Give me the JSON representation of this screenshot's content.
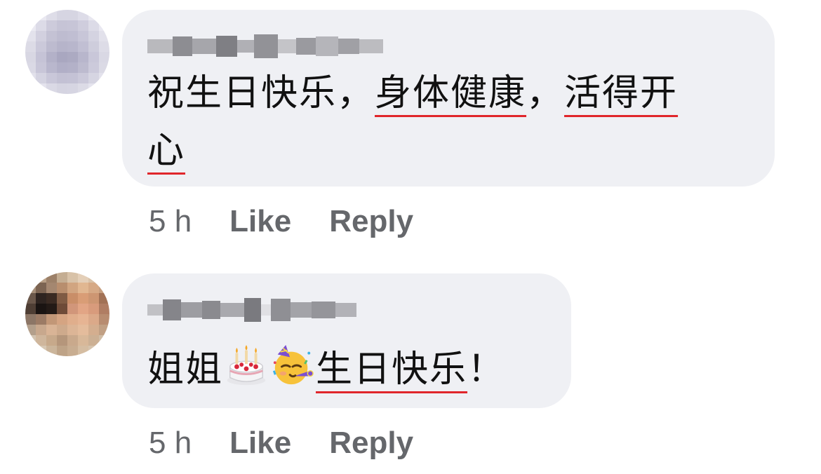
{
  "comments": [
    {
      "author_name": "",
      "text_parts": [
        {
          "t": "祝生日快乐，",
          "u": false
        },
        {
          "t": "身体健康",
          "u": true
        },
        {
          "t": "，",
          "u": false
        },
        {
          "t": "活得开",
          "u": true
        }
      ],
      "text_line2": [
        {
          "t": "心",
          "u": true
        }
      ],
      "time": "5 h",
      "like_label": "Like",
      "reply_label": "Reply"
    },
    {
      "author_name": "",
      "text_before": "姐姐",
      "emojis": [
        "birthday-cake-icon",
        "partying-face-icon"
      ],
      "text_underlined": "生日快乐",
      "text_after": "！",
      "time": "5 h",
      "like_label": "Like",
      "reply_label": "Reply"
    }
  ],
  "colors": {
    "bubble": "#eff0f4",
    "meta_text": "#65676b",
    "spellcheck_underline": "#e0262b"
  }
}
